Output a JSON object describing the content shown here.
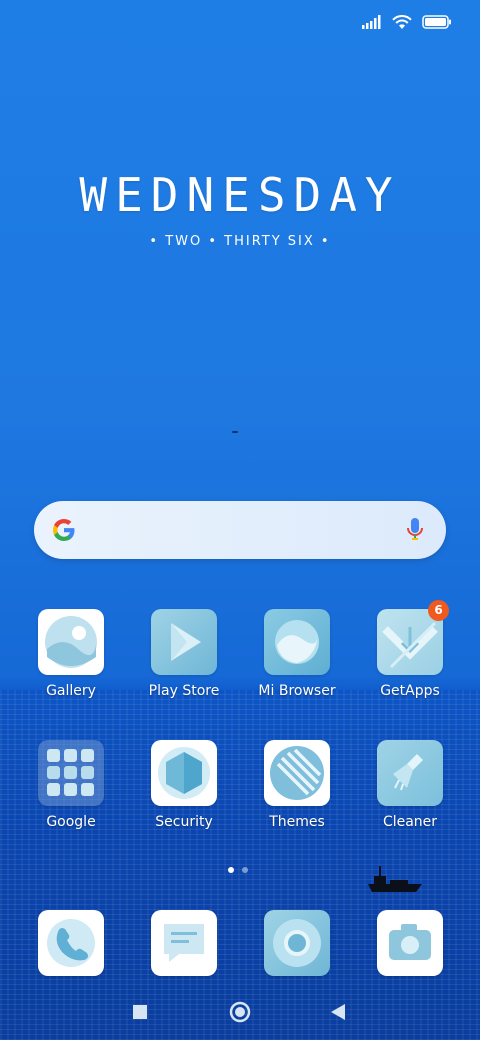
{
  "status": {
    "signal_icon": "signal-icon",
    "wifi_icon": "wifi-icon",
    "battery_icon": "battery-icon"
  },
  "clock": {
    "day": "WEDNESDAY",
    "time": "• TWO • THIRTY SIX •"
  },
  "search": {
    "google_icon": "google-g-icon",
    "mic_icon": "microphone-icon"
  },
  "apps_row1": [
    {
      "label": "Gallery",
      "icon": "gallery-icon"
    },
    {
      "label": "Play Store",
      "icon": "play-store-icon"
    },
    {
      "label": "Mi Browser",
      "icon": "mi-browser-icon"
    },
    {
      "label": "GetApps",
      "icon": "getapps-icon",
      "badge": "6"
    }
  ],
  "apps_row2": [
    {
      "label": "Google",
      "icon": "google-folder-icon"
    },
    {
      "label": "Security",
      "icon": "security-icon"
    },
    {
      "label": "Themes",
      "icon": "themes-icon"
    },
    {
      "label": "Cleaner",
      "icon": "cleaner-icon"
    }
  ],
  "dock": [
    {
      "icon": "phone-icon"
    },
    {
      "icon": "messages-icon"
    },
    {
      "icon": "chrome-icon"
    },
    {
      "icon": "camera-icon"
    }
  ],
  "page_indicator": {
    "pages": 2,
    "current": 1
  },
  "navbar": {
    "recents_icon": "recents-icon",
    "home_icon": "home-icon",
    "back_icon": "back-icon"
  },
  "colors": {
    "sky": "#1f7ee6",
    "sea": "#0b46b0",
    "badge": "#f05a1e"
  }
}
